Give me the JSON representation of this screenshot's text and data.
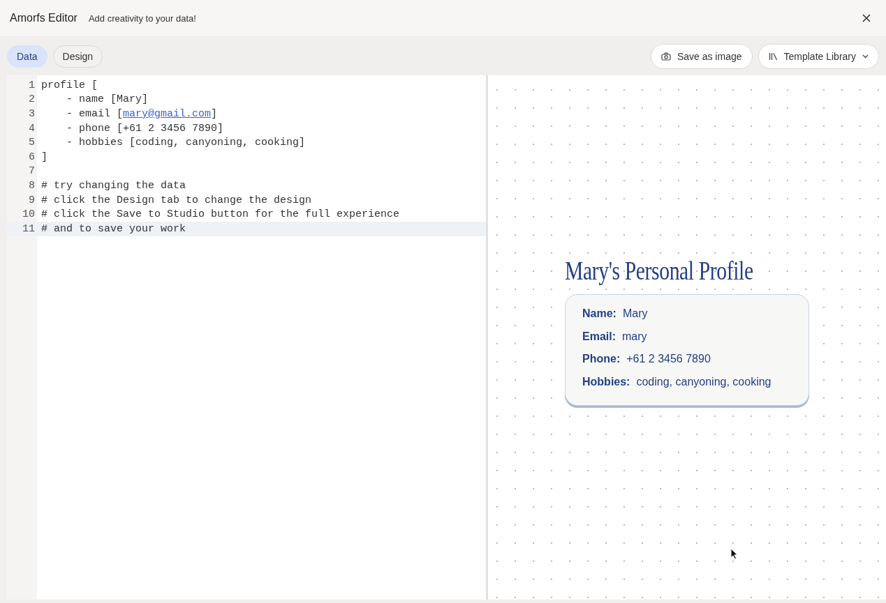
{
  "window": {
    "title": "Amorfs Editor",
    "subtitle": "Add creativity to your data!"
  },
  "tabs": [
    {
      "label": "Data",
      "selected": true
    },
    {
      "label": "Design",
      "selected": false
    }
  ],
  "actions": [
    {
      "label": "Save as image",
      "kind": "camera"
    },
    {
      "label": "Template Library",
      "kind": "library"
    }
  ],
  "editor": {
    "lines": [
      {
        "number": "1",
        "active": false,
        "segments": [
          {
            "text": "profile [",
            "kind": "plain"
          }
        ]
      },
      {
        "number": "2",
        "active": false,
        "segments": [
          {
            "text": "    - name [Mary]",
            "kind": "plain"
          }
        ]
      },
      {
        "number": "3",
        "active": false,
        "segments": [
          {
            "text": "    - email [",
            "kind": "plain"
          },
          {
            "text": "mary@gmail.com",
            "kind": "link"
          },
          {
            "text": "]",
            "kind": "plain"
          }
        ]
      },
      {
        "number": "4",
        "active": false,
        "segments": [
          {
            "text": "    - phone [+61 2 3456 7890]",
            "kind": "plain"
          }
        ]
      },
      {
        "number": "5",
        "active": false,
        "segments": [
          {
            "text": "    - hobbies [coding, canyoning, cooking]",
            "kind": "plain"
          }
        ]
      },
      {
        "number": "6",
        "active": false,
        "segments": [
          {
            "text": "]",
            "kind": "plain"
          }
        ]
      },
      {
        "number": "7",
        "active": false
      },
      {
        "number": "8",
        "active": false,
        "segments": [
          {
            "text": "# try changing the data",
            "kind": "plain"
          }
        ]
      },
      {
        "number": "9",
        "active": false,
        "segments": [
          {
            "text": "# click the Design tab to change the design",
            "kind": "plain"
          }
        ]
      },
      {
        "number": "10",
        "active": false,
        "segments": [
          {
            "text": "# click the Save to Studio button for the full experience",
            "kind": "plain"
          }
        ]
      },
      {
        "number": "11",
        "active": true,
        "segments": [
          {
            "text": "# and to save your work",
            "kind": "plain"
          }
        ]
      }
    ]
  },
  "preview": {
    "title": "Mary's Personal Profile",
    "fields": [
      {
        "label": "Name:",
        "value": "Mary"
      },
      {
        "label": "Email:",
        "value": "mary"
      },
      {
        "label": "Phone:",
        "value": "+61 2 3456 7890"
      },
      {
        "label": "Hobbies:",
        "value": "coding, canyoning, cooking"
      }
    ]
  }
}
